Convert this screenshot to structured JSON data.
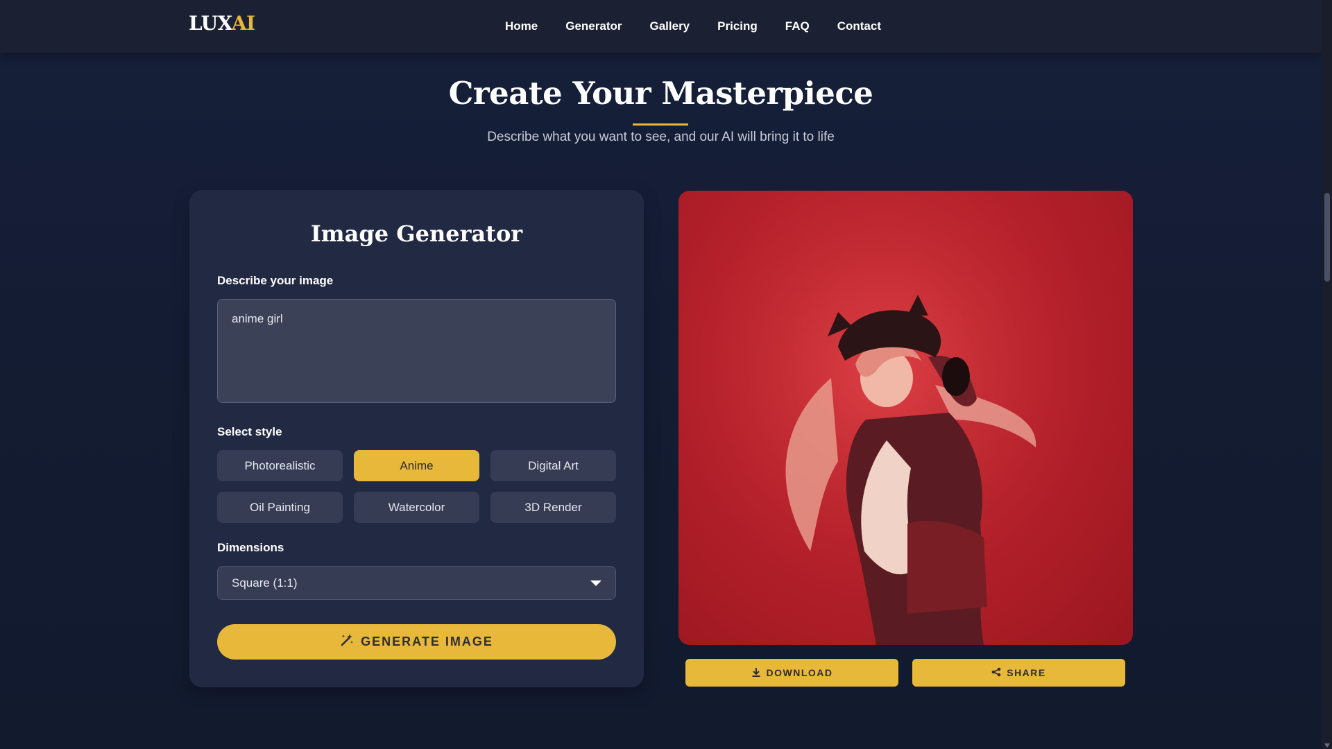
{
  "brand": {
    "lux": "LUX",
    "ai": "AI",
    "accent_color": "#e8b83a"
  },
  "nav": {
    "links": [
      "Home",
      "Generator",
      "Gallery",
      "Pricing",
      "FAQ",
      "Contact"
    ]
  },
  "hero": {
    "title": "Create Your Masterpiece",
    "subtitle": "Describe what you want to see, and our AI will bring it to life"
  },
  "generator": {
    "title": "Image Generator",
    "prompt_label": "Describe your image",
    "prompt_value": "anime girl",
    "style_label": "Select style",
    "styles": [
      "Photorealistic",
      "Anime",
      "Digital Art",
      "Oil Painting",
      "Watercolor",
      "3D Render"
    ],
    "selected_style": "Anime",
    "dimensions_label": "Dimensions",
    "dimensions_value": "Square (1:1)",
    "generate_label": "GENERATE IMAGE"
  },
  "result": {
    "image_description": "anime figure with cat-ear cap in front of a red background",
    "download_label": "DOWNLOAD",
    "share_label": "SHARE"
  },
  "icons": {
    "generate": "magic-wand-icon",
    "download": "download-icon",
    "share": "share-icon",
    "dropdown": "chevron-down-icon"
  }
}
